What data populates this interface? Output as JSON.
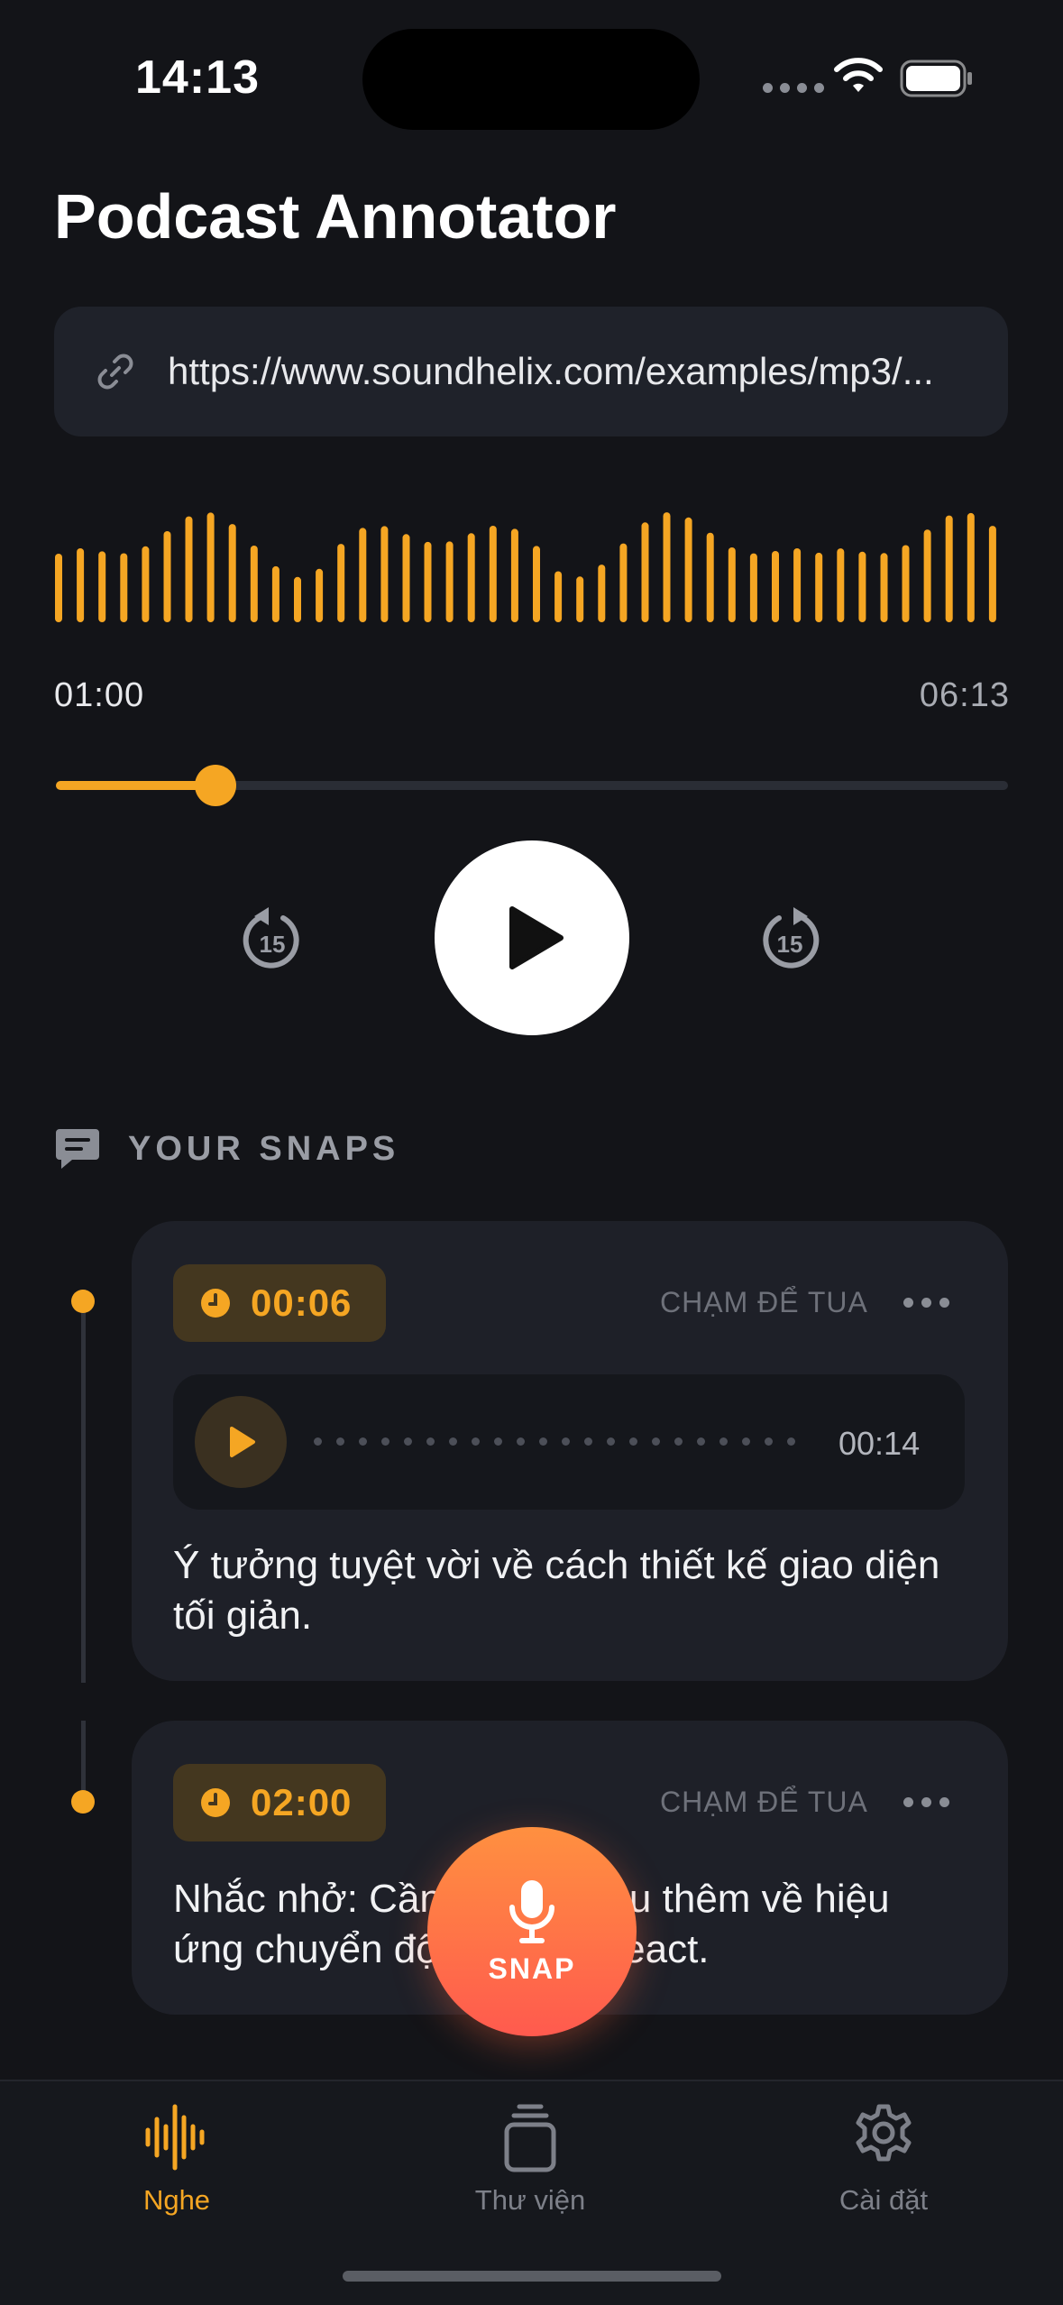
{
  "status_bar": {
    "time": "14:13"
  },
  "app": {
    "title": "Podcast Annotator"
  },
  "url_field": {
    "value": "https://www.soundhelix.com/examples/mp3/..."
  },
  "player": {
    "current_time": "01:00",
    "duration": "06:13",
    "progress": 0.17,
    "skip_back_seconds": "15",
    "skip_forward_seconds": "15"
  },
  "snaps": {
    "heading": "YOUR SNAPS",
    "items": [
      {
        "timestamp": "00:06",
        "seek_hint": "CHẠM ĐỂ TUA",
        "voice_duration": "00:14",
        "note": "Ý tưởng tuyệt vời về cách thiết kế giao diện tối giản."
      },
      {
        "timestamp": "02:00",
        "seek_hint": "CHẠM ĐỂ TUA",
        "note": "Nhắc nhở: Cần nghiên cứu thêm về hiệu ứng chuyển động trong React."
      }
    ]
  },
  "snap_button": {
    "label": "SNAP"
  },
  "tabs": [
    {
      "label": "Nghe",
      "icon": "waveform-icon",
      "active": true
    },
    {
      "label": "Thư viện",
      "icon": "library-icon",
      "active": false
    },
    {
      "label": "Cài đặt",
      "icon": "gear-icon",
      "active": false
    }
  ],
  "colors": {
    "accent": "#f5a623",
    "background": "#131418",
    "card": "#1e2028"
  }
}
